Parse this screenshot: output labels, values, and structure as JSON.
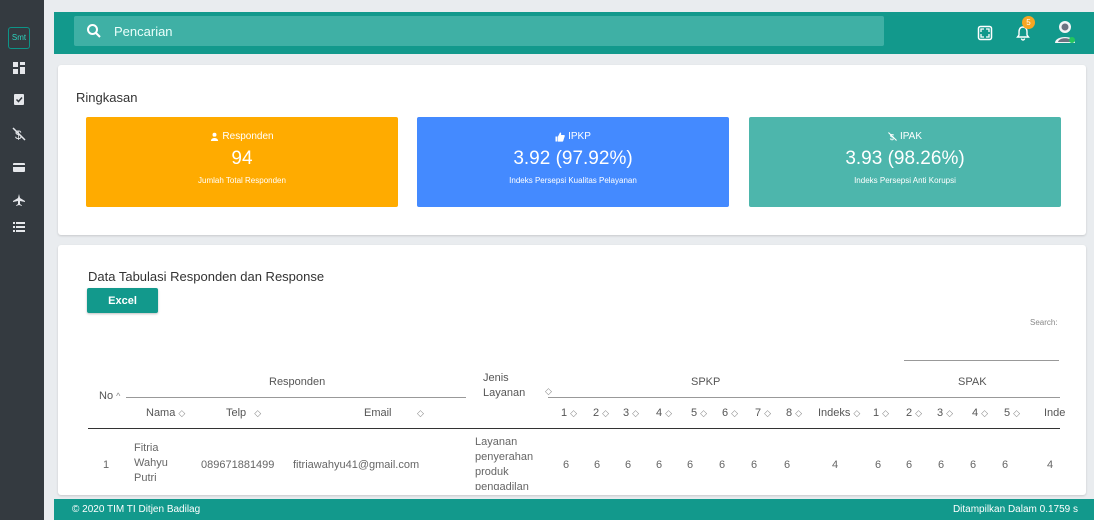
{
  "brand": {
    "logo_text": "Smt"
  },
  "sidebar": {
    "items": [
      {
        "icon": "dashboard-icon"
      },
      {
        "icon": "clipboard-check-icon"
      },
      {
        "icon": "anti-corruption-icon"
      },
      {
        "icon": "card-icon"
      },
      {
        "icon": "plane-icon"
      },
      {
        "icon": "list-icon"
      }
    ]
  },
  "topbar": {
    "search_placeholder": "Pencarian",
    "notification_count": "5"
  },
  "summary": {
    "title": "Ringkasan",
    "cards": [
      {
        "label": "Responden",
        "value": "94",
        "subtitle": "Jumlah Total Responden",
        "color": "#ffab00"
      },
      {
        "label": "IPKP",
        "value": "3.92 (97.92%)",
        "subtitle": "Indeks Persepsi Kualitas Pelayanan",
        "color": "#448aff"
      },
      {
        "label": "IPAK",
        "value": "3.93 (98.26%)",
        "subtitle": "Indeks Persepsi Anti Korupsi",
        "color": "#4db6ac"
      }
    ]
  },
  "table_section": {
    "title": "Data Tabulasi Responden dan Response",
    "excel_label": "Excel",
    "search_label": "Search:",
    "headers": {
      "no": "No",
      "responden": "Responden",
      "nama": "Nama",
      "telp": "Telp",
      "email": "Email",
      "jenis_layanan": "Jenis Layanan",
      "spkp": "SPKP",
      "spak": "SPAK",
      "spkp_cols": [
        "1",
        "2",
        "3",
        "4",
        "5",
        "6",
        "7",
        "8",
        "Indeks"
      ],
      "spak_cols": [
        "1",
        "2",
        "3",
        "4",
        "5",
        "Inde"
      ]
    },
    "rows": [
      {
        "no": "1",
        "nama": "Fitria Wahyu Putri",
        "telp": "089671881499",
        "email": "fitriawahyu41@gmail.com",
        "jenis_layanan": "Layanan penyerahan produk pengadilan",
        "spkp": [
          "6",
          "6",
          "6",
          "6",
          "6",
          "6",
          "6",
          "6",
          "4"
        ],
        "spak": [
          "6",
          "6",
          "6",
          "6",
          "6",
          "4"
        ]
      }
    ]
  },
  "footer": {
    "left": "© 2020 TIM TI Ditjen Badilag",
    "right": "Ditampilkan Dalam 0.1759 s"
  },
  "colors": {
    "primary": "#12998c",
    "sidebar": "#343a40"
  }
}
